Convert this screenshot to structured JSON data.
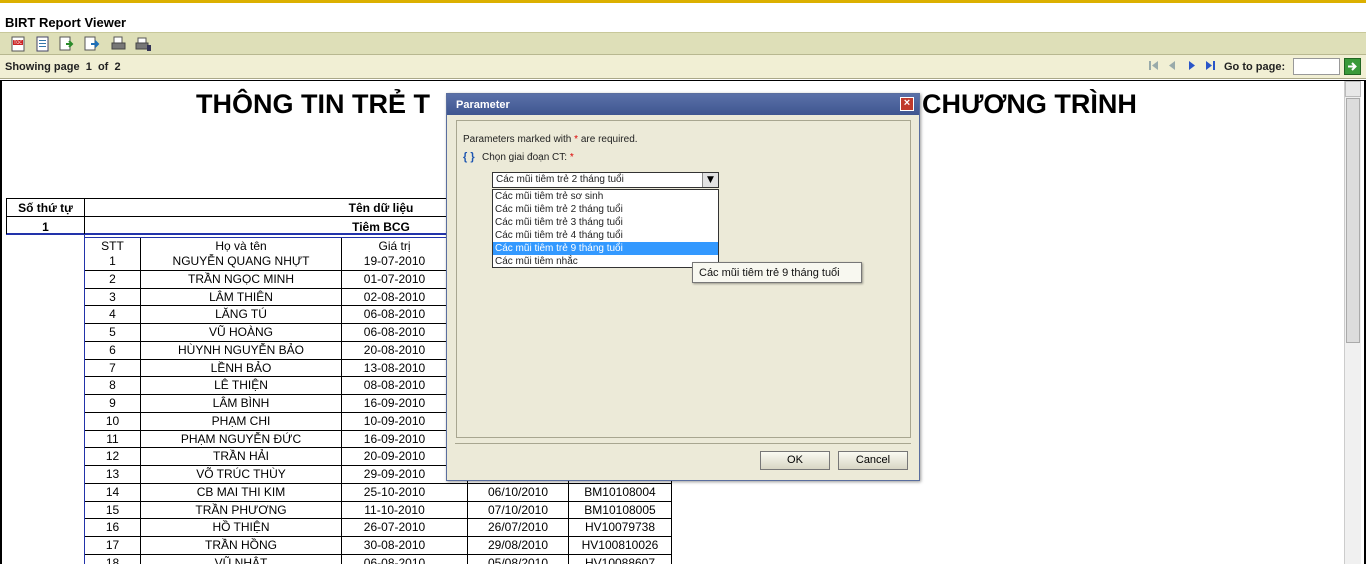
{
  "app": {
    "title": "BIRT Report Viewer"
  },
  "toolbar": {
    "icons": [
      "toc-icon",
      "run-report-icon",
      "export-data-icon",
      "export-report-icon",
      "print-icon",
      "print-server-icon"
    ]
  },
  "navigation": {
    "showing_label": "Showing page",
    "current_page": "1",
    "of_label": "of",
    "total_pages": "2",
    "goto_label": "Go to page:",
    "goto_value": ""
  },
  "report": {
    "title_left": "THÔNG TIN TRẺ T",
    "title_right": "CHƯƠNG TRÌNH",
    "col_so_thu_tu": "Số thứ tự",
    "col_ten_du_lieu": "Tên dữ liệu",
    "group_index": "1",
    "group_name": "Tiêm BCG",
    "sub_headers": {
      "stt": "STT",
      "ho_ten": "Họ và tên",
      "gia_tri": "Giá trị"
    },
    "rows": [
      {
        "stt": "1",
        "name": "NGUYỄN QUANG NHỰT",
        "date": "19-07-2010",
        "date2": "",
        "code": ""
      },
      {
        "stt": "2",
        "name": "TRẦN NGỌC MINH",
        "date": "01-07-2010",
        "date2": "",
        "code": ""
      },
      {
        "stt": "3",
        "name": "LÂM THIÊN",
        "date": "02-08-2010",
        "date2": "",
        "code": ""
      },
      {
        "stt": "4",
        "name": "LĂNG TÚ",
        "date": "06-08-2010",
        "date2": "",
        "code": ""
      },
      {
        "stt": "5",
        "name": "VŨ HOÀNG",
        "date": "06-08-2010",
        "date2": "",
        "code": ""
      },
      {
        "stt": "6",
        "name": "HÙYNH NGUYỄN BẢO",
        "date": "20-08-2010",
        "date2": "",
        "code": ""
      },
      {
        "stt": "7",
        "name": "LỀNH BẢO",
        "date": "13-08-2010",
        "date2": "",
        "code": ""
      },
      {
        "stt": "8",
        "name": "LÊ THIỆN",
        "date": "08-08-2010",
        "date2": "",
        "code": ""
      },
      {
        "stt": "9",
        "name": "LÂM BÌNH",
        "date": "16-09-2010",
        "date2": "",
        "code": ""
      },
      {
        "stt": "10",
        "name": "PHẠM CHI",
        "date": "10-09-2010",
        "date2": "",
        "code": ""
      },
      {
        "stt": "11",
        "name": "PHẠM NGUYỄN ĐỨC",
        "date": "16-09-2010",
        "date2": "",
        "code": ""
      },
      {
        "stt": "12",
        "name": "TRẦN HẢI",
        "date": "20-09-2010",
        "date2": "",
        "code": ""
      },
      {
        "stt": "13",
        "name": "VÕ TRÚC THÙY",
        "date": "29-09-2010",
        "date2": "",
        "code": ""
      },
      {
        "stt": "14",
        "name": "CB  MAI THI KIM",
        "date": "25-10-2010",
        "date2": "06/10/2010",
        "code": "BM10108004"
      },
      {
        "stt": "15",
        "name": "TRẦN PHƯƠNG",
        "date": "11-10-2010",
        "date2": "07/10/2010",
        "code": "BM10108005"
      },
      {
        "stt": "16",
        "name": "HỒ THIỆN",
        "date": "26-07-2010",
        "date2": "26/07/2010",
        "code": "HV10079738"
      },
      {
        "stt": "17",
        "name": "TRẦN HỒNG",
        "date": "30-08-2010",
        "date2": "29/08/2010",
        "code": "HV100810026"
      },
      {
        "stt": "18",
        "name": "VŨ NHẬT",
        "date": "06-08-2010",
        "date2": "05/08/2010",
        "code": "HV10088607"
      }
    ]
  },
  "dialog": {
    "title": "Parameter",
    "required_note_pre": "Parameters marked with",
    "required_star": "*",
    "required_note_post": "are required.",
    "param_label": "Chọn giai đoạn CT:",
    "param_star": "*",
    "selected_value": "Các mũi tiêm trẻ 2 tháng tuổi",
    "options": [
      "Các mũi tiêm trẻ sơ sinh",
      "Các mũi tiêm trẻ 2 tháng tuổi",
      "Các mũi tiêm trẻ 3 tháng tuổi",
      "Các mũi tiêm trẻ 4 tháng tuổi",
      "Các mũi tiêm trẻ 9 tháng tuổi",
      "Các mũi tiêm nhắc"
    ],
    "highlighted_option": "Các mũi tiêm trẻ 9 tháng tuổi",
    "tooltip": "Các mũi tiêm trẻ 9 tháng tuổi",
    "ok_label": "OK",
    "cancel_label": "Cancel"
  }
}
